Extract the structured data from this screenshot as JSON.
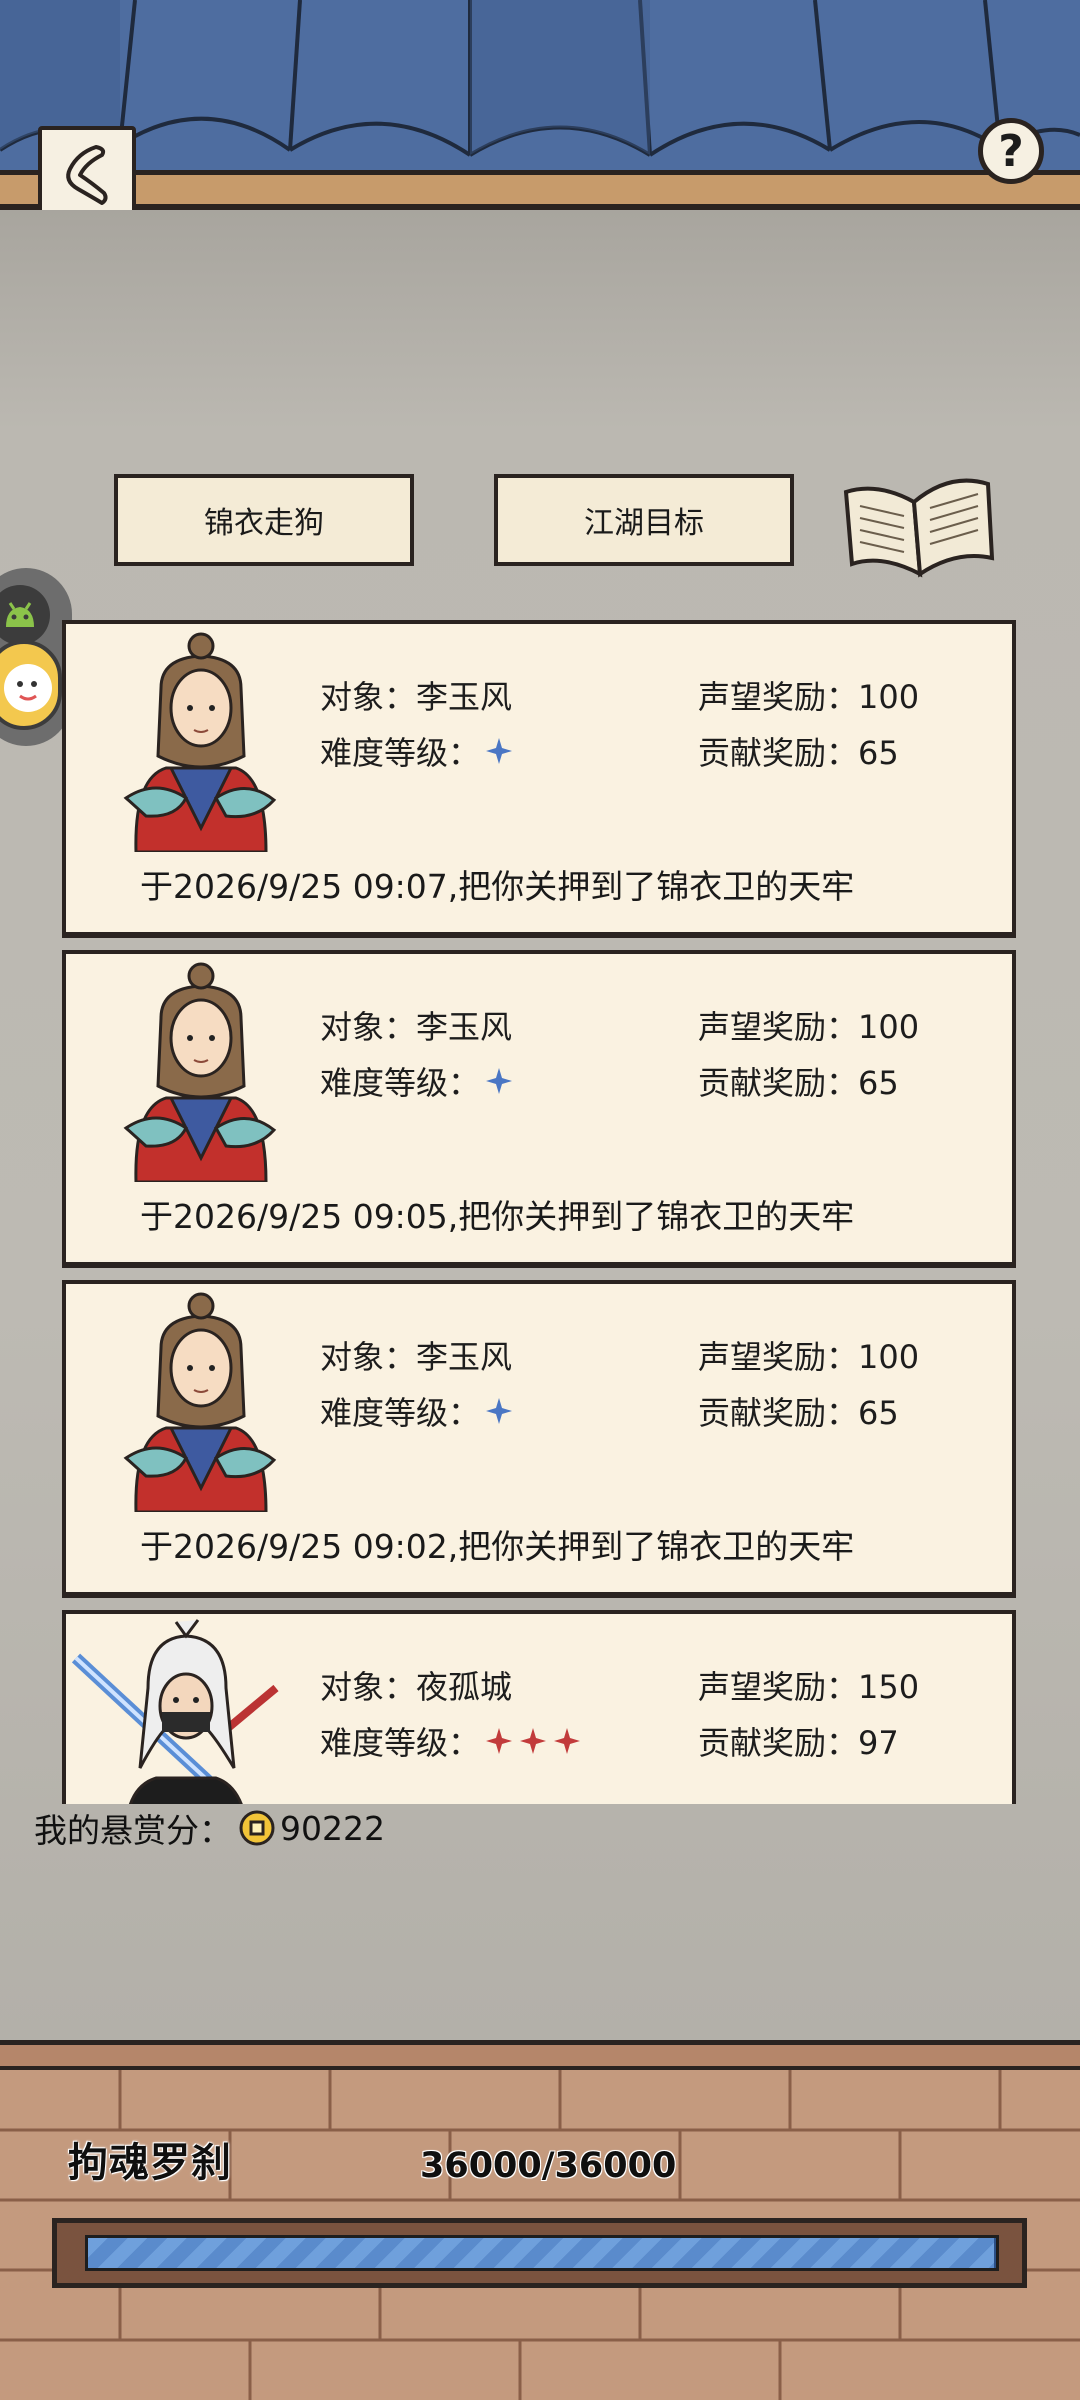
{
  "header": {
    "back_icon": "back-arrow-icon",
    "help_label": "?"
  },
  "tabs": [
    {
      "label": "锦衣走狗"
    },
    {
      "label": "江湖目标"
    }
  ],
  "records": [
    {
      "target_label": "对象：李玉风",
      "difficulty_label": "难度等级：",
      "stars": 1,
      "star_color": "#4a76c4",
      "reputation_label": "声望奖励：100",
      "contribution_label": "贡献奖励：65",
      "description": "于2026/9/25 09:07,把你关押到了锦衣卫的天牢"
    },
    {
      "target_label": "对象：李玉风",
      "difficulty_label": "难度等级：",
      "stars": 1,
      "star_color": "#4a76c4",
      "reputation_label": "声望奖励：100",
      "contribution_label": "贡献奖励：65",
      "description": "于2026/9/25 09:05,把你关押到了锦衣卫的天牢"
    },
    {
      "target_label": "对象：李玉风",
      "difficulty_label": "难度等级：",
      "stars": 1,
      "star_color": "#4a76c4",
      "reputation_label": "声望奖励：100",
      "contribution_label": "贡献奖励：65",
      "description": "于2026/9/25 09:02,把你关押到了锦衣卫的天牢"
    },
    {
      "target_label": "对象：夜孤城",
      "difficulty_label": "难度等级：",
      "stars": 3,
      "star_color": "#c23b3b",
      "reputation_label": "声望奖励：150",
      "contribution_label": "贡献奖励：97",
      "description": ""
    }
  ],
  "bounty": {
    "label": "我的悬赏分：",
    "value": "90222"
  },
  "boss": {
    "name": "拘魂罗刹",
    "hp_text": "36000/36000",
    "hp_fraction": 1.0
  },
  "colors": {
    "roof_blue": "#4e6da0",
    "card_bg": "#faf2e1",
    "hp_blue": "#6fa0dc"
  }
}
